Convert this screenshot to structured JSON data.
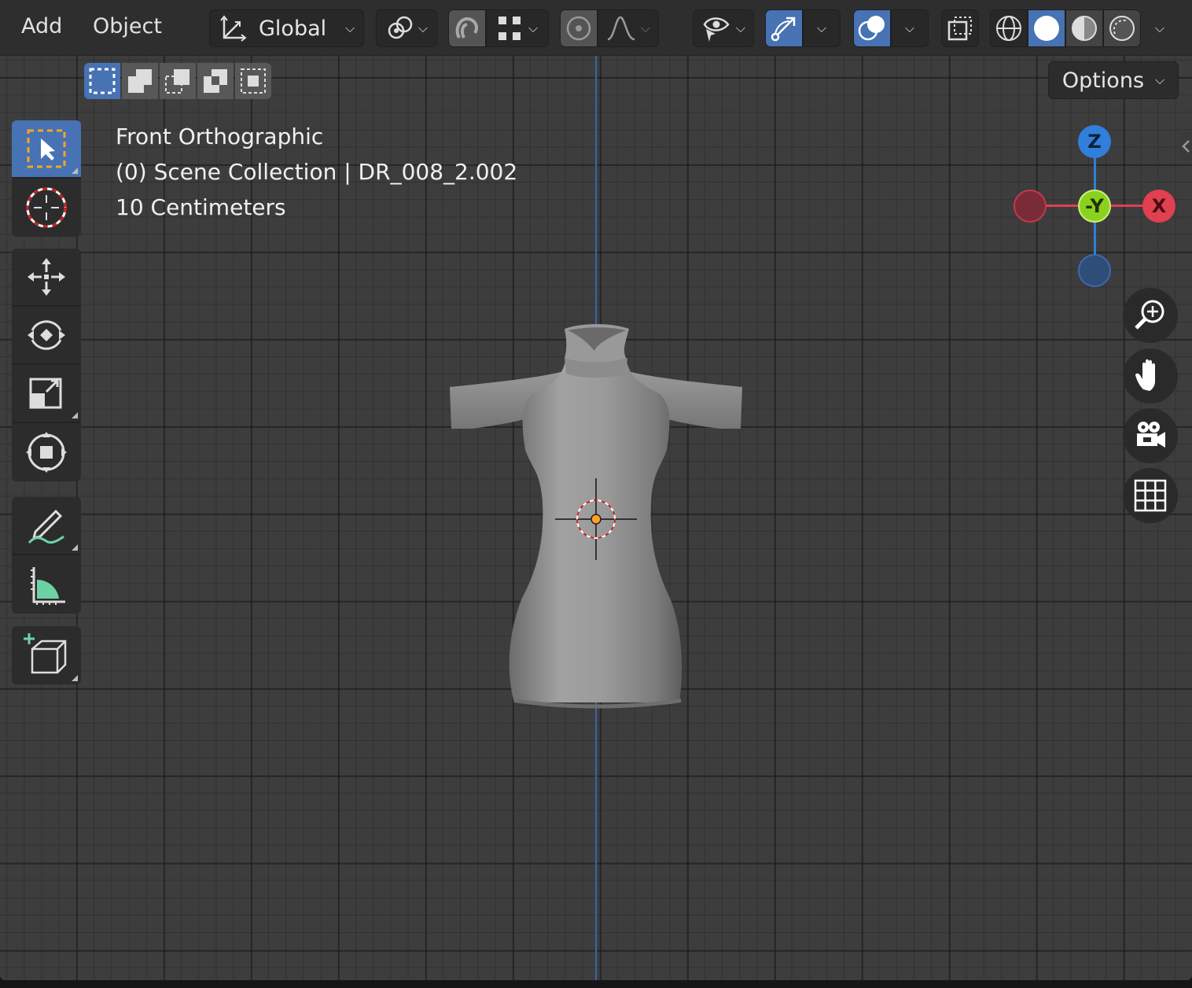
{
  "header": {
    "menu": [
      "Add",
      "Object"
    ],
    "transform_orientation": "Global",
    "options_label": "Options"
  },
  "overlay": {
    "view_name": "Front Orthographic",
    "collection": "(0) Scene Collection | DR_008_2.002",
    "grid_scale": "10 Centimeters"
  },
  "gizmo": {
    "z_label": "Z",
    "y_label": "-Y",
    "x_label": "X",
    "colors": {
      "x": "#e0404f",
      "y": "#8bd11f",
      "z": "#2f7fdb"
    }
  },
  "toolbar": {
    "tools": [
      "select-box",
      "cursor",
      "move",
      "rotate",
      "scale",
      "transform",
      "annotate",
      "measure",
      "add-cube"
    ],
    "active_tool": "select-box"
  },
  "shading": {
    "active_mode": "solid"
  },
  "colors": {
    "accent": "#4772b3",
    "background": "#3d3d3d"
  }
}
